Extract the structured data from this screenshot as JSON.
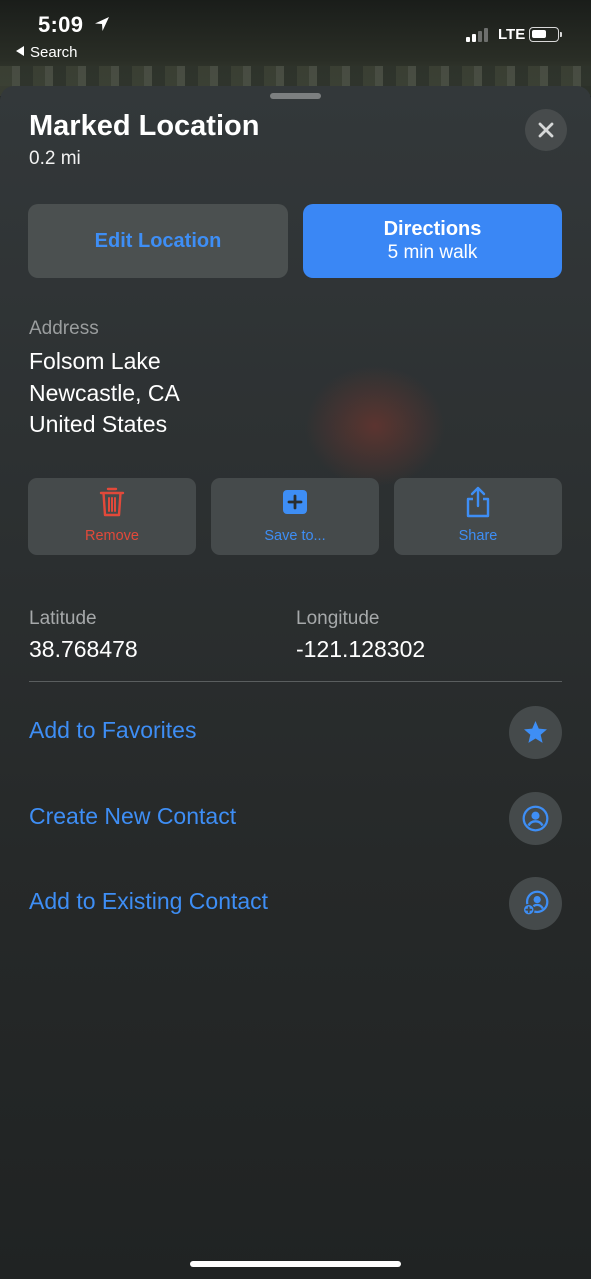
{
  "status": {
    "time": "5:09",
    "back_label": "Search",
    "network": "LTE"
  },
  "sheet": {
    "title": "Marked Location",
    "distance": "0.2 mi",
    "edit_label": "Edit Location",
    "directions_label": "Directions",
    "directions_sub": "5 min walk"
  },
  "address": {
    "label": "Address",
    "line1": "Folsom Lake",
    "line2": "Newcastle, CA",
    "line3": "United States"
  },
  "actions": {
    "remove": "Remove",
    "save": "Save to...",
    "share": "Share"
  },
  "coords": {
    "lat_label": "Latitude",
    "lat_value": "38.768478",
    "lon_label": "Longitude",
    "lon_value": "-121.128302"
  },
  "links": {
    "favorites": "Add to Favorites",
    "new_contact": "Create New Contact",
    "existing_contact": "Add to Existing Contact"
  },
  "colors": {
    "accent": "#3e8ef5",
    "destructive": "#e2493a",
    "directions_bg": "#3a87f5"
  },
  "icons": [
    "location-arrow-icon",
    "signal-icon",
    "battery-icon",
    "close-icon",
    "trash-icon",
    "plus-square-icon",
    "share-icon",
    "star-icon",
    "contact-icon",
    "add-contact-icon"
  ]
}
